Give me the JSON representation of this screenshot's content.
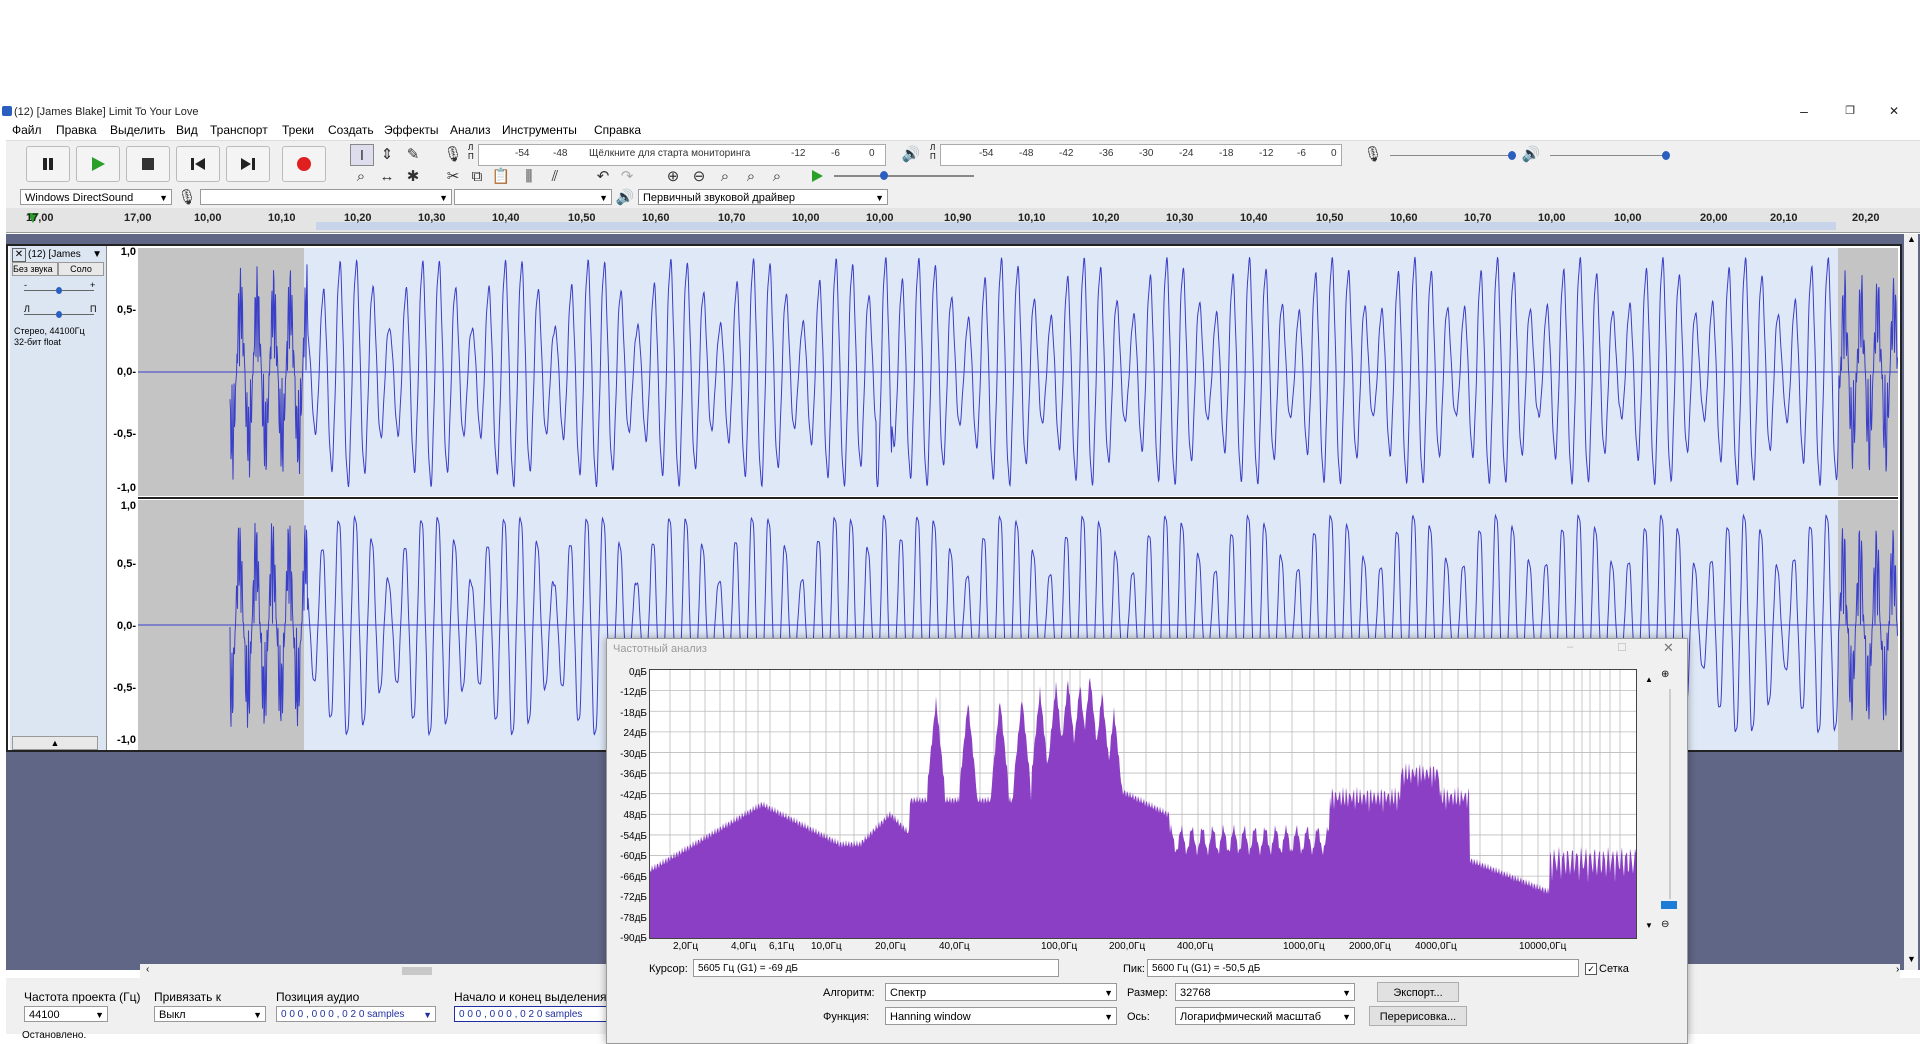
{
  "window": {
    "title": "(12) [James Blake] Limit To Your Love",
    "minimize": "–",
    "restore": "❐",
    "close": "✕"
  },
  "menu": [
    "Файл",
    "Правка",
    "Выделить",
    "Вид",
    "Транспорт",
    "Треки",
    "Создать",
    "Эффекты",
    "Анализ",
    "Инструменты",
    "Справка"
  ],
  "meters": {
    "record_ticks": [
      "-54",
      "-48",
      "Щёлкните для старта мониторинга",
      "-12",
      "-6",
      "0"
    ],
    "record_lr": [
      "Л",
      "П"
    ],
    "play_ticks": [
      "-54",
      "-48",
      "-42",
      "-36",
      "-30",
      "-24",
      "-18",
      "-12",
      "-6",
      "0"
    ],
    "play_lr": [
      "Л",
      "П"
    ]
  },
  "device": {
    "host": "Windows DirectSound",
    "record_device": "",
    "channels": "",
    "playback_device": "Первичный звуковой драйвер"
  },
  "ruler": {
    "ticks": [
      "17,00",
      "17,00",
      "10,00",
      "10,10",
      "10,20",
      "10,30",
      "10,40",
      "10,50",
      "10,60",
      "10,70",
      "10,00",
      "10,00",
      "10,90",
      "10,10",
      "10,20",
      "10,30",
      "10,40",
      "10,50",
      "10,60",
      "10,70",
      "10,00",
      "10,00",
      "20,00",
      "20,10",
      "20,20"
    ]
  },
  "track": {
    "name": "(12) [James",
    "mute": "Без звука",
    "solo": "Соло",
    "info1": "Стерео, 44100Гц",
    "info2": "32-бит float",
    "gain_minus": "-",
    "gain_plus": "+",
    "pan_left": "Л",
    "pan_right": "П",
    "scale": [
      "1,0",
      "0,5-",
      "0,0-",
      "-0,5-",
      "-1,0"
    ]
  },
  "bottom": {
    "rate_label": "Частота проекта (Гц)",
    "rate_value": "44100",
    "snap_label": "Привязать к",
    "snap_value": "Выкл",
    "pos_label": "Позиция аудио",
    "pos_value": "0 0 0 , 0 0 0 , 0 2 0 samples",
    "sel_label": "Начало и конец выделения",
    "sel_value": "0 0 0 , 0 0 0 , 0 2 0 samples",
    "status": "Остановлено."
  },
  "dialog": {
    "title": "Частотный анализ",
    "db_labels": [
      "0дБ",
      "-12дБ",
      "-18дБ",
      "24дБ",
      "-30дБ",
      "-36дБ",
      "-42дБ",
      "48дБ",
      "-54дБ",
      "-60дБ",
      "-66дБ",
      "-72дБ",
      "-78дБ",
      "-90дБ"
    ],
    "freq_labels": [
      "2,0Гц",
      "4,0Гц",
      "6,1Гц",
      "10,0Гц",
      "20,0Гц",
      "40,0Гц",
      "100,0Гц",
      "200,0Гц",
      "400,0Гц",
      "1000,0Гц",
      "2000,0Гц",
      "4000,0Гц",
      "10000,0Гц"
    ],
    "cursor_label": "Курсор:",
    "cursor_value": "5605 Гц (G1) = -69 дБ",
    "peak_label": "Пик:",
    "peak_value": "5600 Гц (G1) = -50,5 дБ",
    "grid_label": "Сетка",
    "algorithm_label": "Алгоритм:",
    "algorithm_value": "Спектр",
    "size_label": "Размер:",
    "size_value": "32768",
    "export_button": "Экспорт...",
    "function_label": "Функция:",
    "function_value": "Hanning window",
    "axis_label": "Ось:",
    "axis_value": "Логарифмический масштаб",
    "replot_button": "Перерисовка...",
    "spectrum_color": "#8a3fc4"
  },
  "colors": {
    "wave": "#3a3fc8",
    "wave_bg": "#dfe8f6",
    "track_area": "#606685",
    "record": "#e02020",
    "play": "#2aa02a"
  }
}
